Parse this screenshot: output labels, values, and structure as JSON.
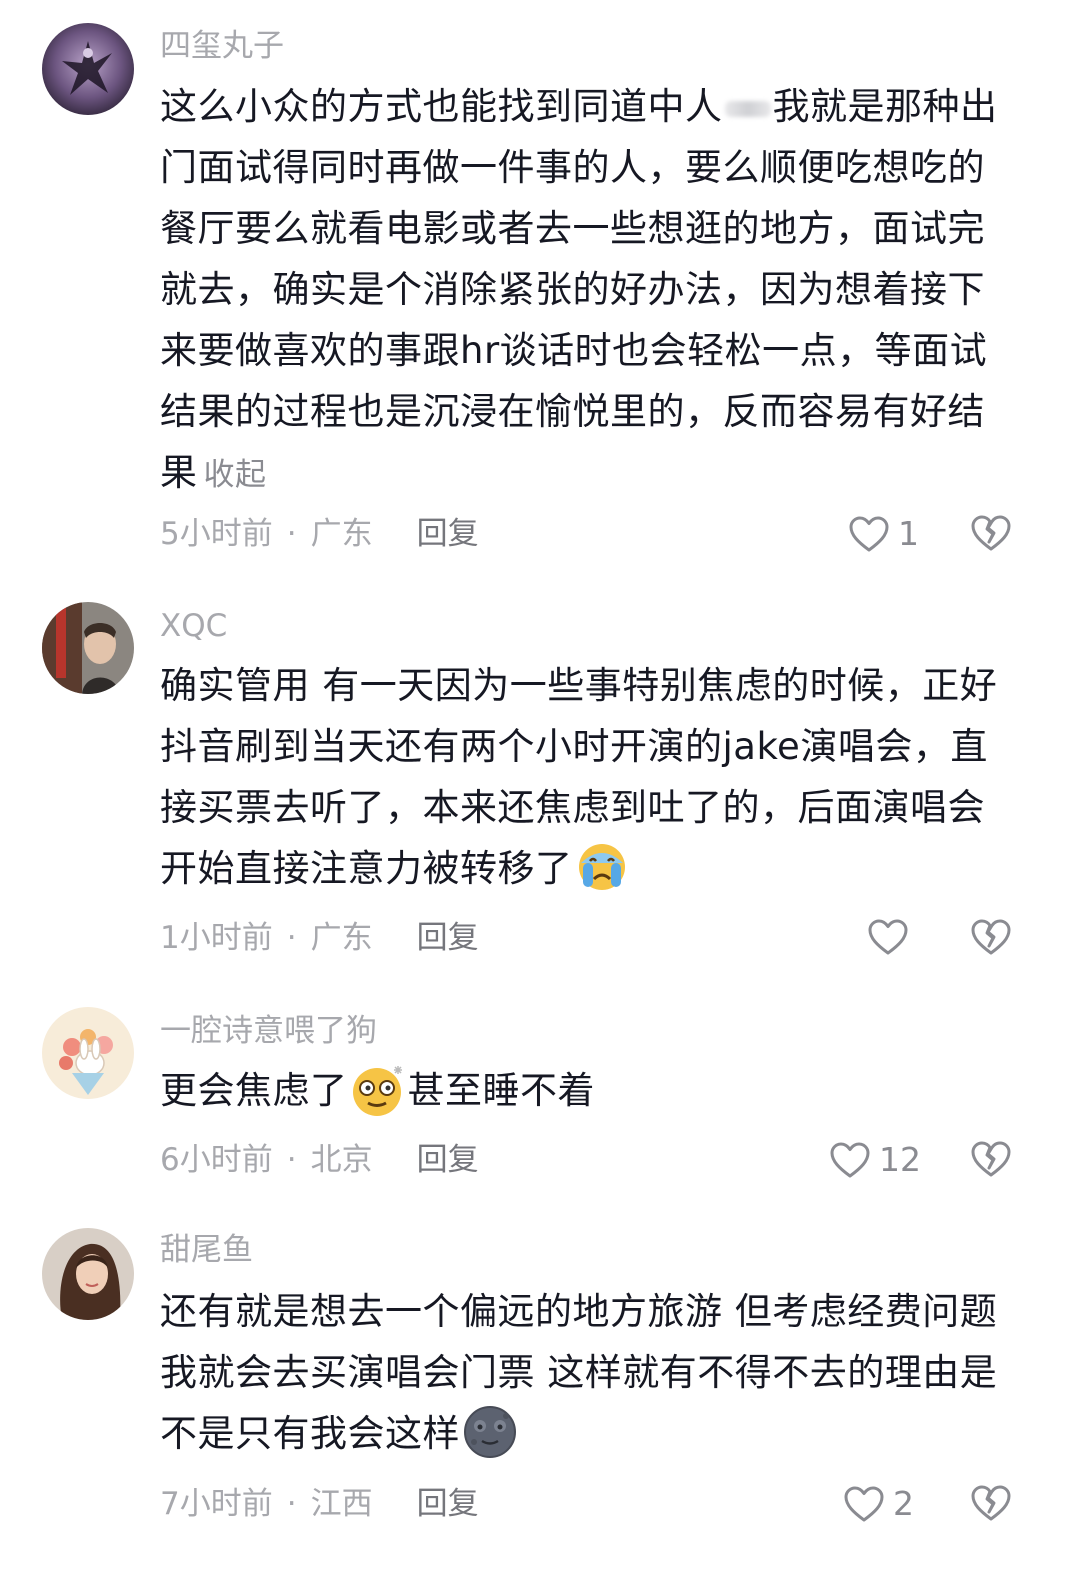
{
  "comments": [
    {
      "username": "四玺丸子",
      "text_before_blur": "这么小众的方式也能找到同道中人",
      "text_after_blur": "我就是那种出门面试得同时再做一件事的人，要么顺便吃想吃的餐厅要么就看电影或者去一些想逛的地方，面试完就去，确实是个消除紧张的好办法，因为想着接下来要做喜欢的事跟hr谈话时也会轻松一点，等面试结果的过程也是沉浸在愉悦里的，反而容易有好结果",
      "collapse_label": "收起",
      "time": "5小时前",
      "location": "广东",
      "reply_label": "回复",
      "like_count": "1"
    },
    {
      "username": "XQC",
      "text": "确实管用 有一天因为一些事特别焦虑的时候，正好抖音刷到当天还有两个小时开演的jake演唱会，直接买票去听了，本来还焦虑到吐了的，后面演唱会开始直接注意力被转移了",
      "emoji": "crying-face",
      "time": "1小时前",
      "location": "广东",
      "reply_label": "回复",
      "like_count": ""
    },
    {
      "username": "一腔诗意喂了狗",
      "text_before_emoji": "更会焦虑了",
      "emoji": "dizzy-face",
      "text_after_emoji": "甚至睡不着",
      "time": "6小时前",
      "location": "北京",
      "reply_label": "回复",
      "like_count": "12"
    },
    {
      "username": "甜尾鱼",
      "text": "还有就是想去一个偏远的地方旅游 但考虑经费问题我就会去买演唱会门票 这样就有不得不去的理由是不是只有我会这样",
      "emoji": "moon-face",
      "time": "7小时前",
      "location": "江西",
      "reply_label": "回复",
      "like_count": "2"
    }
  ],
  "separator": "·",
  "colors": {
    "text": "#161823",
    "meta": "#a7a8ad",
    "reply": "#75767c",
    "icon": "#8a8b91"
  }
}
